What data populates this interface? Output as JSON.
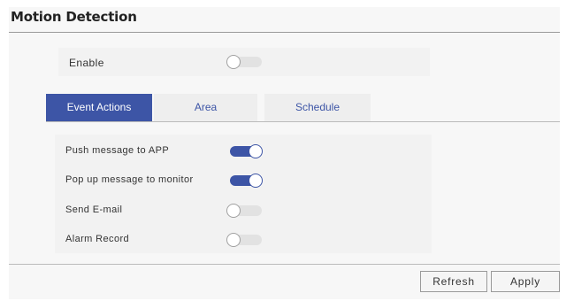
{
  "section_title": "Motion Detection",
  "enable": {
    "label": "Enable",
    "state": "off"
  },
  "tabs": [
    {
      "label": "Event Actions",
      "active": true
    },
    {
      "label": "Area",
      "active": false
    },
    {
      "label": "Schedule",
      "active": false
    }
  ],
  "event_actions": [
    {
      "label": "Push message to APP",
      "state": "on"
    },
    {
      "label": "Pop up message to monitor",
      "state": "on"
    },
    {
      "label": "Send E-mail",
      "state": "off"
    },
    {
      "label": "Alarm Record",
      "state": "off"
    }
  ],
  "buttons": {
    "refresh": "Refresh",
    "apply": "Apply"
  },
  "colors": {
    "accent": "#3d55a6",
    "toggle_off": "#e2e2e2",
    "panel_bg": "#f7f7f7"
  }
}
